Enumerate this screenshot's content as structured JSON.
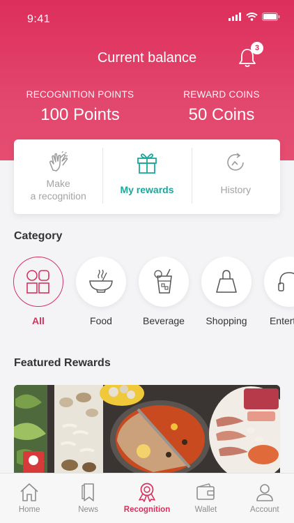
{
  "status": {
    "time": "9:41"
  },
  "header": {
    "title": "Current balance",
    "notification_count": "3",
    "recognition_points_label": "RECOGNITION POINTS",
    "recognition_points_value": "100 Points",
    "reward_coins_label": "REWARD COINS",
    "reward_coins_value": "50 Coins"
  },
  "actions": [
    {
      "line1": "Make",
      "line2": "a recognition",
      "icon": "clapping-hands-icon"
    },
    {
      "label": "My rewards",
      "icon": "gift-icon"
    },
    {
      "label": "History",
      "icon": "history-icon"
    }
  ],
  "category": {
    "title": "Category",
    "items": [
      {
        "label": "All",
        "icon": "grid-shapes-icon"
      },
      {
        "label": "Food",
        "icon": "bowl-icon"
      },
      {
        "label": "Beverage",
        "icon": "drink-icon"
      },
      {
        "label": "Shopping",
        "icon": "shopping-bag-icon"
      },
      {
        "label": "Entertain",
        "icon": "headphones-icon"
      }
    ]
  },
  "featured": {
    "title": "Featured Rewards"
  },
  "tabs": [
    {
      "label": "Home",
      "icon": "home-icon"
    },
    {
      "label": "News",
      "icon": "news-icon"
    },
    {
      "label": "Recognition",
      "icon": "ribbon-icon"
    },
    {
      "label": "Wallet",
      "icon": "wallet-icon"
    },
    {
      "label": "Account",
      "icon": "account-icon"
    }
  ],
  "colors": {
    "brand": "#dd2e5c",
    "accent_teal": "#1aa79c",
    "muted": "#a3a3a3"
  }
}
